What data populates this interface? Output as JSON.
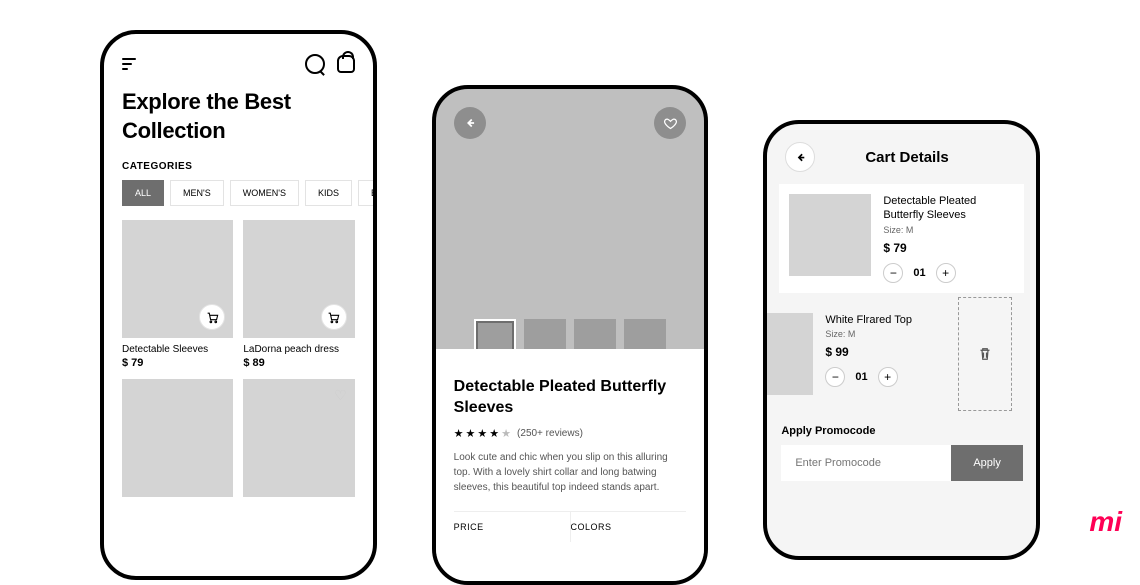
{
  "screen1": {
    "title": "Explore the Best Collection",
    "categories_label": "CATEGORIES",
    "categories": [
      "ALL",
      "MEN'S",
      "WOMEN'S",
      "KIDS",
      "BEAUTY"
    ],
    "products": [
      {
        "name": "Detectable Sleeves",
        "price": "$ 79"
      },
      {
        "name": "LaDorna peach dress",
        "price": "$ 89"
      }
    ]
  },
  "screen2": {
    "title": "Detectable Pleated Butterfly Sleeves",
    "reviews": "(250+ reviews)",
    "description": "Look cute and chic when you slip on this alluring top. With a lovely shirt collar and long batwing sleeves, this beautiful top indeed stands apart.",
    "price_label": "PRICE",
    "colors_label": "COLORS"
  },
  "screen3": {
    "title": "Cart Details",
    "items": [
      {
        "name": "Detectable Pleated Butterfly Sleeves",
        "size": "Size: M",
        "price": "$ 79",
        "qty": "01"
      },
      {
        "name": "White Flrared Top",
        "size": "Size: M",
        "price": "$ 99",
        "qty": "01"
      }
    ],
    "promo_label": "Apply Promocode",
    "promo_placeholder": "Enter Promocode",
    "apply_label": "Apply"
  },
  "logo": "mi"
}
